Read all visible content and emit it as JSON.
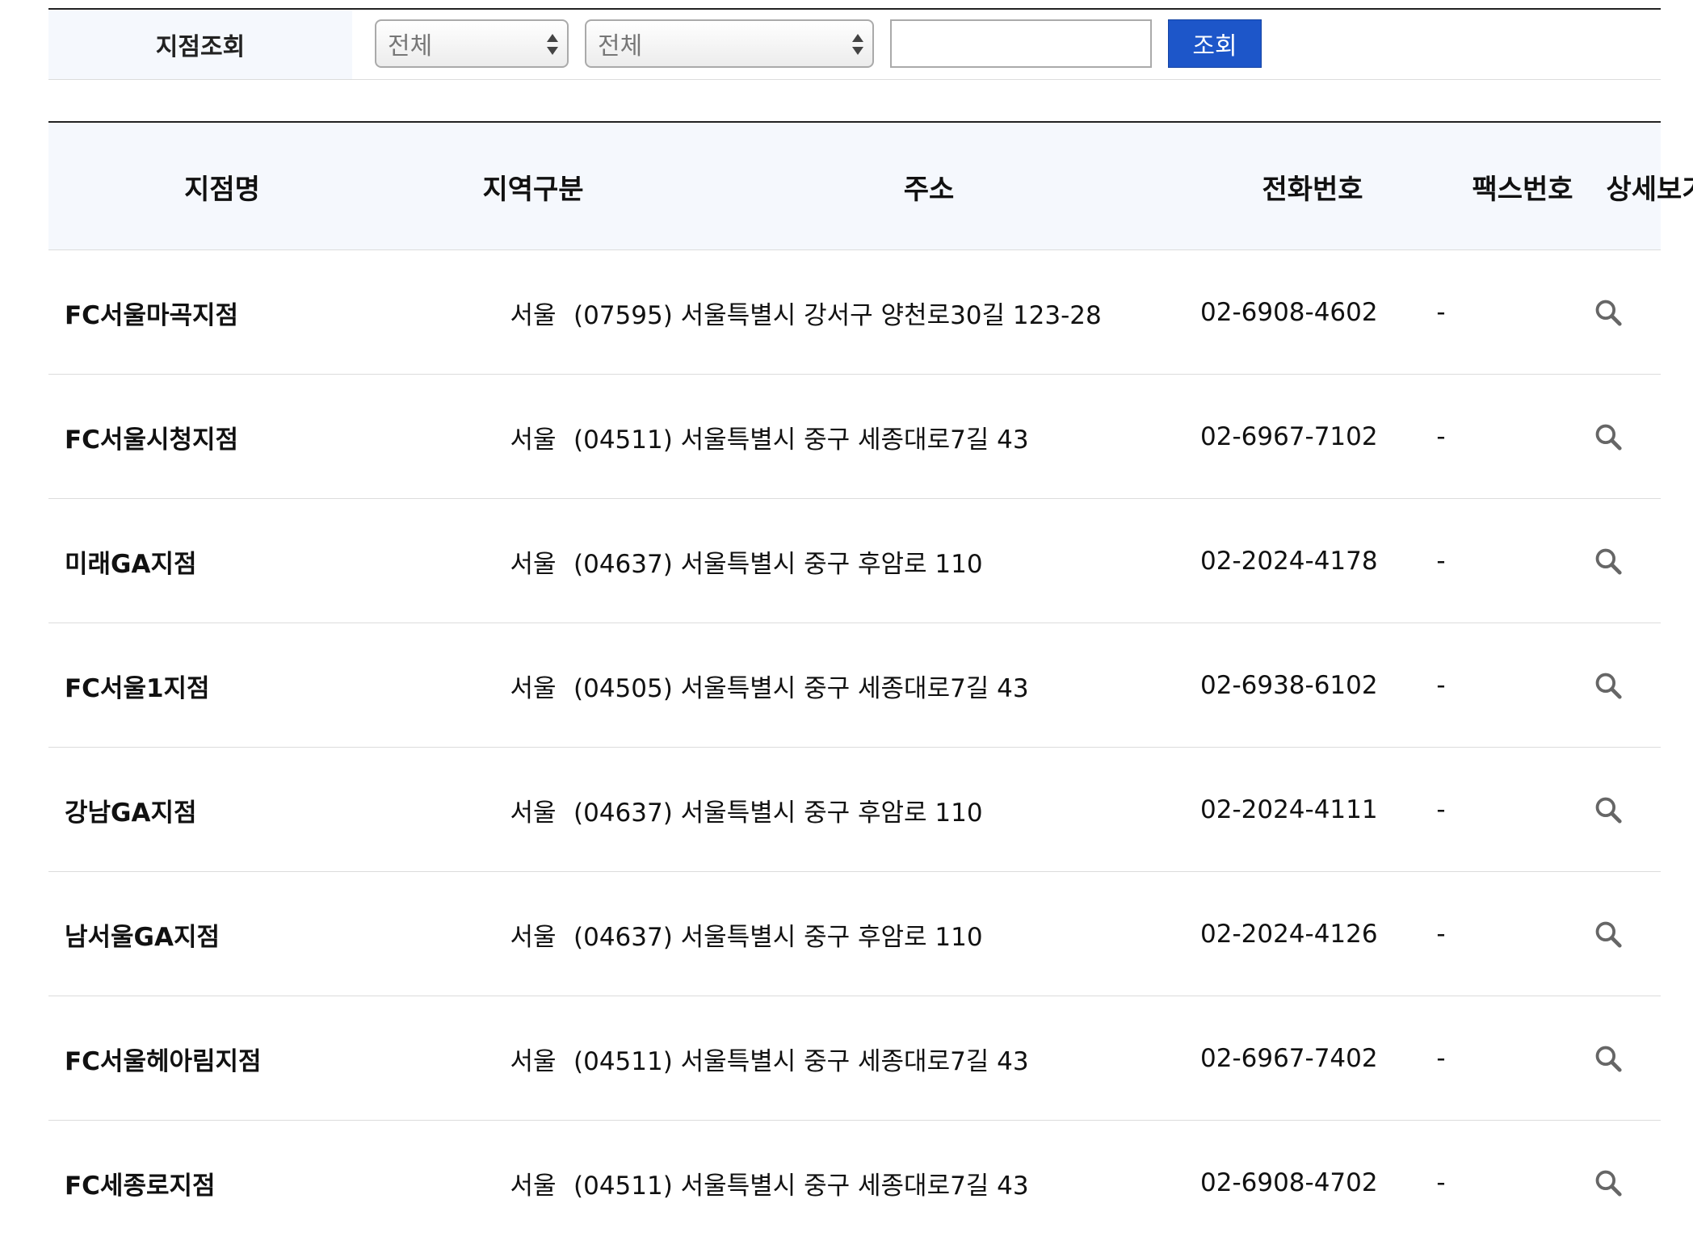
{
  "search": {
    "label": "지점조회",
    "select1": "전체",
    "select2": "전체",
    "input_value": "",
    "button": "조회"
  },
  "table": {
    "headers": {
      "name": "지점명",
      "region": "지역구분",
      "address": "주소",
      "phone": "전화번호",
      "fax": "팩스번호",
      "detail": "상세보기"
    },
    "rows": [
      {
        "name": "FC서울마곡지점",
        "region": "서울",
        "address": "(07595) 서울특별시 강서구 양천로30길 123-28",
        "phone": "02-6908-4602",
        "fax": "-"
      },
      {
        "name": "FC서울시청지점",
        "region": "서울",
        "address": "(04511) 서울특별시 중구 세종대로7길 43",
        "phone": "02-6967-7102",
        "fax": "-"
      },
      {
        "name": "미래GA지점",
        "region": "서울",
        "address": "(04637) 서울특별시 중구 후암로 110",
        "phone": "02-2024-4178",
        "fax": "-"
      },
      {
        "name": "FC서울1지점",
        "region": "서울",
        "address": "(04505) 서울특별시 중구 세종대로7길 43",
        "phone": "02-6938-6102",
        "fax": "-"
      },
      {
        "name": "강남GA지점",
        "region": "서울",
        "address": "(04637) 서울특별시 중구 후암로 110",
        "phone": "02-2024-4111",
        "fax": "-"
      },
      {
        "name": "남서울GA지점",
        "region": "서울",
        "address": "(04637) 서울특별시 중구 후암로 110",
        "phone": "02-2024-4126",
        "fax": "-"
      },
      {
        "name": "FC서울헤아림지점",
        "region": "서울",
        "address": "(04511) 서울특별시 중구 세종대로7길 43",
        "phone": "02-6967-7402",
        "fax": "-"
      },
      {
        "name": "FC세종로지점",
        "region": "서울",
        "address": "(04511) 서울특별시 중구 세종대로7길 43",
        "phone": "02-6908-4702",
        "fax": "-"
      }
    ]
  },
  "icons": {
    "detail": "search-icon"
  },
  "colors": {
    "accent": "#1d56c9",
    "header_bg": "#f5f8fd",
    "border": "#dcdcdc"
  }
}
